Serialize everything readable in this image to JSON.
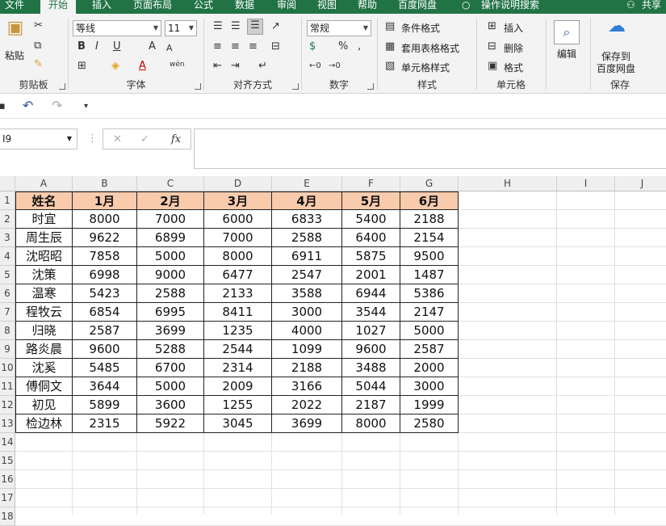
{
  "tabs": [
    "文件",
    "开始",
    "插入",
    "页面布局",
    "公式",
    "数据",
    "审阅",
    "视图",
    "帮助",
    "百度网盘"
  ],
  "tell_me": "操作说明搜索",
  "share": "共享",
  "ribbon": {
    "clipboard": {
      "paste": "粘贴",
      "label": "剪贴板"
    },
    "font": {
      "name": "等线",
      "size": "11",
      "label": "字体",
      "bold": "B",
      "italic": "I",
      "underline": "U",
      "grow": "A",
      "shrink": "A",
      "font_color_letter": "A",
      "phonetic": "wén"
    },
    "alignment": {
      "label": "对齐方式"
    },
    "number": {
      "format": "常规",
      "percent": "%",
      "comma": ",",
      "label": "数字"
    },
    "styles": {
      "conditional": "条件格式",
      "table": "套用表格格式",
      "cell_styles": "单元格样式",
      "label": "样式"
    },
    "cells": {
      "insert": "插入",
      "delete": "删除",
      "format": "格式",
      "label": "单元格"
    },
    "editing": {
      "label": "编辑"
    },
    "save": {
      "label1": "保存到",
      "label2": "百度网盘",
      "group": "保存"
    }
  },
  "namebox": "I9",
  "fx": "fx",
  "columns": [
    "A",
    "B",
    "C",
    "D",
    "E",
    "F",
    "G",
    "H",
    "I",
    "J"
  ],
  "row_numbers": [
    "1",
    "2",
    "3",
    "4",
    "5",
    "6",
    "7",
    "8",
    "9",
    "10",
    "11",
    "12",
    "13",
    "14",
    "15",
    "16",
    "17",
    "18"
  ],
  "colors": {
    "header_fill": "#f8cbad",
    "brand": "#217346"
  },
  "table": {
    "headers": [
      "姓名",
      "1月",
      "2月",
      "3月",
      "4月",
      "5月",
      "6月"
    ],
    "rows": [
      [
        "时宜",
        "8000",
        "7000",
        "6000",
        "6833",
        "5400",
        "2188"
      ],
      [
        "周生辰",
        "9622",
        "6899",
        "7000",
        "2588",
        "6400",
        "2154"
      ],
      [
        "沈昭昭",
        "7858",
        "5000",
        "8000",
        "6911",
        "5875",
        "9500"
      ],
      [
        "沈策",
        "6998",
        "9000",
        "6477",
        "2547",
        "2001",
        "1487"
      ],
      [
        "温寒",
        "5423",
        "2588",
        "2133",
        "3588",
        "6944",
        "5386"
      ],
      [
        "程牧云",
        "6854",
        "6995",
        "8411",
        "3000",
        "3544",
        "2147"
      ],
      [
        "归晓",
        "2587",
        "3699",
        "1235",
        "4000",
        "1027",
        "5000"
      ],
      [
        "路炎晨",
        "9600",
        "5288",
        "2544",
        "1099",
        "9600",
        "2587"
      ],
      [
        "沈奚",
        "5485",
        "6700",
        "2314",
        "2188",
        "3488",
        "2000"
      ],
      [
        "傅侗文",
        "3644",
        "5000",
        "2009",
        "3166",
        "5044",
        "3000"
      ],
      [
        "初见",
        "5899",
        "3600",
        "1255",
        "2022",
        "2187",
        "1999"
      ],
      [
        "检边林",
        "2315",
        "5922",
        "3045",
        "3699",
        "8000",
        "2580"
      ]
    ]
  }
}
